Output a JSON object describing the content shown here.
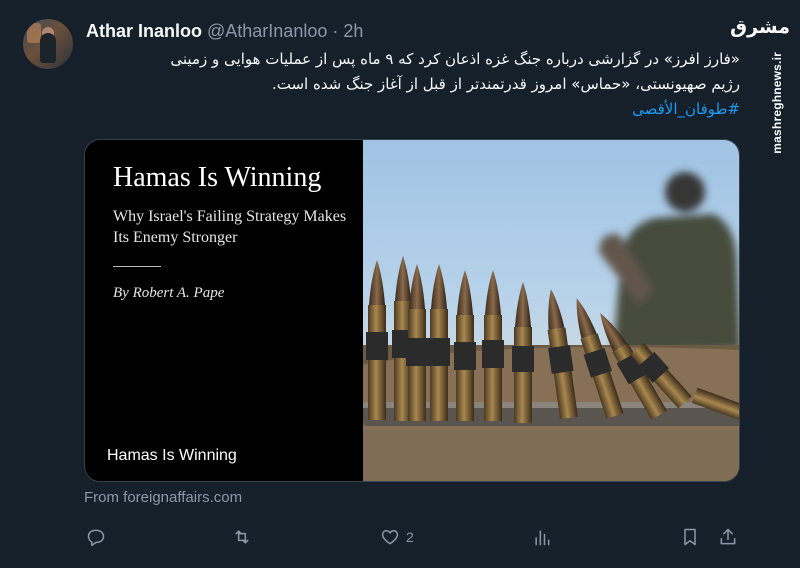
{
  "tweet": {
    "author_name": "Athar Inanloo",
    "handle": "@AtharInanloo",
    "separator": "·",
    "time": "2h",
    "text_lines": [
      "«فارز افرز» در گزارشی درباره جنگ غزه اذعان کرد که ۹ ماه پس از عملیات هوایی و زمینی",
      "رژیم صهیونستی، «حماس» امروز قدرتمندتر از قبل از آغاز جنگ شده است."
    ],
    "hashtag": "#طوفان_الأقصى"
  },
  "watermark": {
    "logo": "مشرق",
    "site": "mashreghnews.ir"
  },
  "card": {
    "title": "Hamas Is Winning",
    "subtitle": "Why Israel's Failing Strategy Makes Its Enemy Stronger",
    "author": "By Robert A. Pape",
    "caption": "Hamas Is Winning",
    "source": "From foreignaffairs.com"
  },
  "actions": {
    "reply_icon": "reply-icon",
    "retweet_icon": "retweet-icon",
    "like_icon": "heart-icon",
    "like_count": "2",
    "views_icon": "analytics-icon",
    "bookmark_icon": "bookmark-icon",
    "share_icon": "share-icon"
  },
  "colors": {
    "background": "#15202b",
    "text": "#f7f9f9",
    "muted": "#8b98a5",
    "link": "#1d9bf0",
    "border": "#38444d"
  }
}
